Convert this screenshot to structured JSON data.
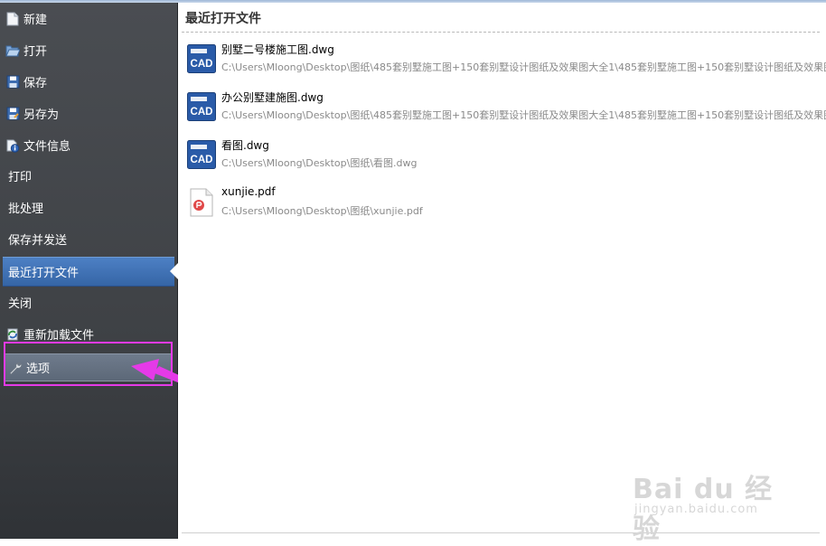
{
  "sidebar": {
    "items": [
      {
        "label": "新建",
        "icon": "new-file-icon"
      },
      {
        "label": "打开",
        "icon": "folder-open-icon"
      },
      {
        "label": "保存",
        "icon": "save-icon"
      },
      {
        "label": "另存为",
        "icon": "save-as-icon"
      },
      {
        "label": "文件信息",
        "icon": "info-icon"
      },
      {
        "label": "打印"
      },
      {
        "label": "批处理"
      },
      {
        "label": "保存并发送"
      },
      {
        "label": "最近打开文件",
        "state": "active"
      },
      {
        "label": "关闭"
      },
      {
        "label": "重新加载文件",
        "icon": "reload-icon"
      },
      {
        "label": "选项",
        "icon": "wrench-icon",
        "state": "hover"
      }
    ]
  },
  "recent": {
    "title": "最近打开文件",
    "files": [
      {
        "name": "别墅二号楼施工图.dwg",
        "path": "C:\\Users\\Mloong\\Desktop\\图纸\\485套别墅施工图+150套别墅设计图纸及效果图大全1\\485套别墅施工图+150套别墅设计图纸及效果图大全",
        "icon_text": "CAD",
        "icon": "cad-file-icon"
      },
      {
        "name": "办公别墅建施图.dwg",
        "path": "C:\\Users\\Mloong\\Desktop\\图纸\\485套别墅施工图+150套别墅设计图纸及效果图大全1\\485套别墅施工图+150套别墅设计图纸及效果图大全",
        "icon_text": "CAD",
        "icon": "cad-file-icon"
      },
      {
        "name": "看图.dwg",
        "path": "C:\\Users\\Mloong\\Desktop\\图纸\\看图.dwg",
        "icon_text": "CAD",
        "icon": "cad-file-icon"
      },
      {
        "name": "xunjie.pdf",
        "path": "C:\\Users\\Mloong\\Desktop\\图纸\\xunjie.pdf",
        "icon": "pdf-file-icon"
      }
    ]
  },
  "watermark": {
    "main": "Bai du 经验",
    "sub": "jingyan.baidu.com"
  },
  "colors": {
    "active": "#3f70b3",
    "annotation": "#e53ae8"
  }
}
